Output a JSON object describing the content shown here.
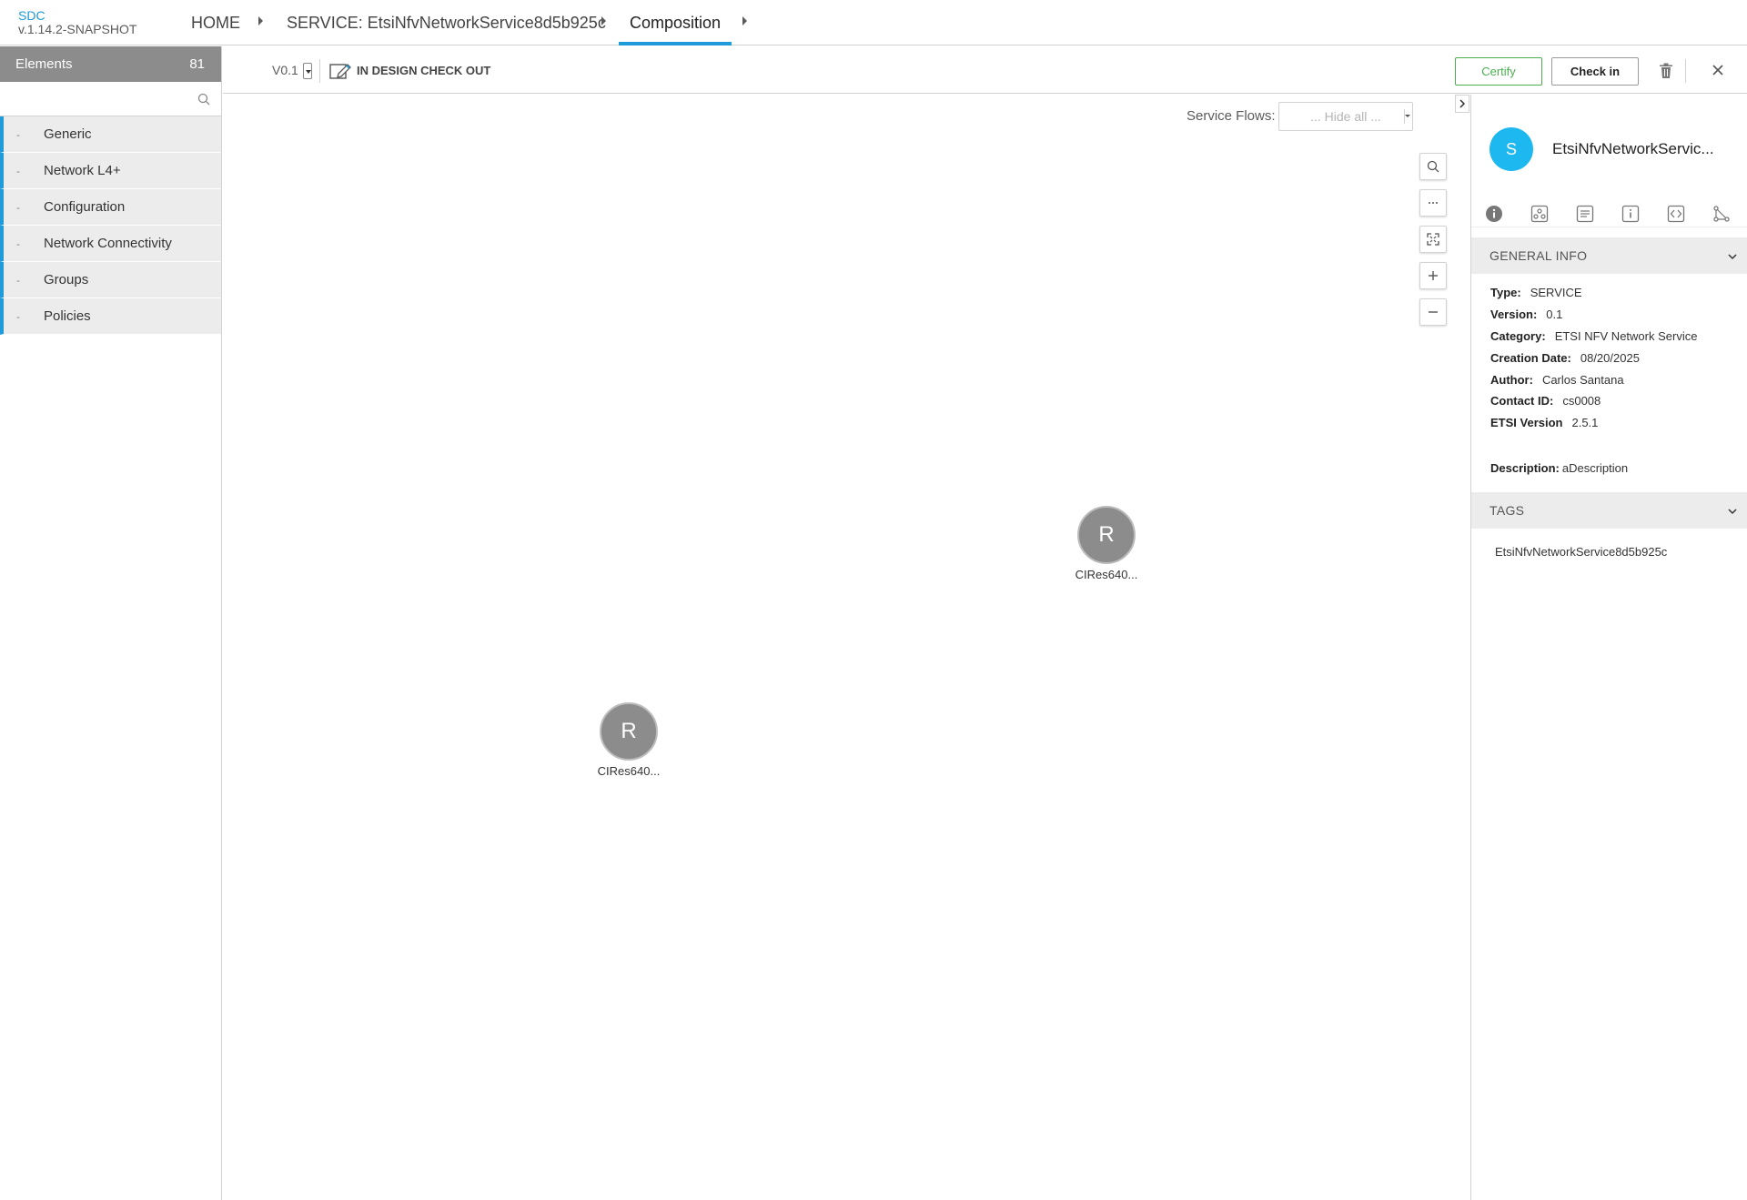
{
  "brand": {
    "app": "SDC",
    "version": "v.1.14.2-SNAPSHOT"
  },
  "breadcrumb": {
    "home": "HOME",
    "service": "SERVICE: EtsiNfvNetworkService8d5b925c",
    "composition": "Composition"
  },
  "palette": {
    "title": "Elements",
    "count": "81",
    "search_placeholder": "",
    "categories": [
      {
        "dash": "-",
        "label": "Generic"
      },
      {
        "dash": "-",
        "label": "Network L4+"
      },
      {
        "dash": "-",
        "label": "Configuration"
      },
      {
        "dash": "-",
        "label": "Network Connectivity"
      },
      {
        "dash": "-",
        "label": "Groups"
      },
      {
        "dash": "-",
        "label": "Policies"
      }
    ]
  },
  "toolbar": {
    "version": "V0.1",
    "status": "IN DESIGN CHECK OUT",
    "certify_label": "Certify",
    "checkin_label": "Check in",
    "icons": [
      "design-status-icon",
      "trash-icon",
      "close-icon"
    ]
  },
  "canvas": {
    "service_flows_label": "Service Flows:",
    "service_flows_value": "... Hide all ...",
    "zoom_controls": [
      "search-icon",
      "more-icon",
      "fit-icon",
      "plus-icon",
      "minus-icon"
    ],
    "nodes": [
      {
        "letter": "R",
        "label": "CIRes640..."
      },
      {
        "letter": "R",
        "label": "CIRes640..."
      }
    ]
  },
  "details": {
    "avatar_letter": "S",
    "name": "EtsiNfvNetworkServic...",
    "tabs": [
      "info-icon",
      "composition-icon",
      "deployment-icon",
      "properties-icon",
      "api-icon",
      "relations-icon"
    ],
    "general_info_title": "GENERAL INFO",
    "rows": [
      {
        "label": "Type:",
        "value": "SERVICE"
      },
      {
        "label": "Version:",
        "value": "0.1"
      },
      {
        "label": "Category:",
        "value": "ETSI NFV Network Service"
      },
      {
        "label": "Creation Date:",
        "value": "08/20/2025"
      },
      {
        "label": "Author:",
        "value": "Carlos Santana"
      },
      {
        "label": "Contact ID:",
        "value": "cs0008"
      },
      {
        "label": "ETSI Version",
        "value": "2.5.1"
      }
    ],
    "description_label": "Description:",
    "description_value": "aDescription",
    "tags_title": "TAGS",
    "tag": "EtsiNfvNetworkService8d5b925c"
  },
  "colors": {
    "accent": "#1e9bd8",
    "certify": "#4caf50",
    "avatar": "#1eb8f0",
    "node": "#8c8c8c"
  }
}
